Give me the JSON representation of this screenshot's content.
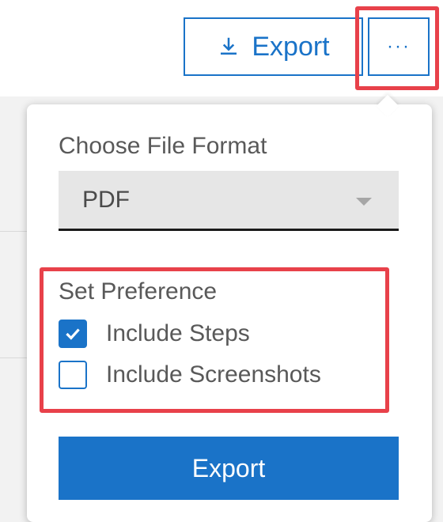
{
  "toolbar": {
    "export_label": "Export",
    "more_label": "···",
    "export_icon": "download-icon"
  },
  "popover": {
    "format_label": "Choose File Format",
    "format_selected": "PDF",
    "preference_label": "Set Preference",
    "options": [
      {
        "label": "Include Steps",
        "checked": true
      },
      {
        "label": "Include Screenshots",
        "checked": false
      }
    ],
    "submit_label": "Export"
  },
  "colors": {
    "accent": "#1a73c8",
    "highlight": "#e8414a"
  }
}
